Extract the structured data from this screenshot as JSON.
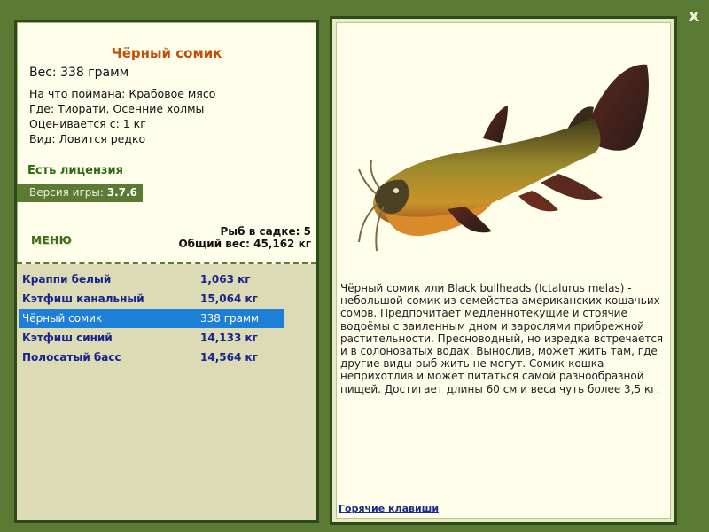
{
  "close_label": "x",
  "fish": {
    "name": "Чёрный сомик",
    "weight": "Вес: 338 грамм",
    "bait": "На что поймана: Крабовое мясо",
    "location": "Где: Тиорати, Осенние холмы",
    "value": "Оценивается с: 1 кг",
    "rarity": "Вид: Ловится редко",
    "description": "Чёрный сомик или Black bullheads (Ictalurus melas) - небольшой сомик из семейства американских кошачьих сомов. Предпочитает медленнотекущие и стоячие водоёмы с заиленным дном и зарослями прибрежной растительности. Пресноводный, но изредка встречается и в солоноватых водах. Вынослив, может жить там, где другие виды рыб жить не могут. Сомик-кошка неприхотлив и может питаться самой разнообразной пищей. Достигает длины 60 см и веса чуть более 3,5 кг."
  },
  "license": "Есть лицензия",
  "version": {
    "label": "Версия игры:",
    "value": "3.7.6"
  },
  "menu_label": "МЕНЮ",
  "stats": {
    "in_tank": "Рыб в садке: 5",
    "total_weight": "Общий вес: 45,162 кг"
  },
  "catch_list": [
    {
      "name": "Краппи белый",
      "weight": "1,063 кг",
      "selected": false
    },
    {
      "name": "Кэтфиш канальный",
      "weight": "15,064 кг",
      "selected": false
    },
    {
      "name": "Чёрный сомик",
      "weight": "338 грамм",
      "selected": true
    },
    {
      "name": "Кэтфиш синий",
      "weight": "14,133 кг",
      "selected": false
    },
    {
      "name": "Полосатый басс",
      "weight": "14,564 кг",
      "selected": false
    }
  ],
  "hotkeys_label": "Горячие клавиши",
  "colors": {
    "bg": "#5b7a34",
    "panel": "#fffeea",
    "title": "#c0500c",
    "selected": "#1e7fd6"
  }
}
